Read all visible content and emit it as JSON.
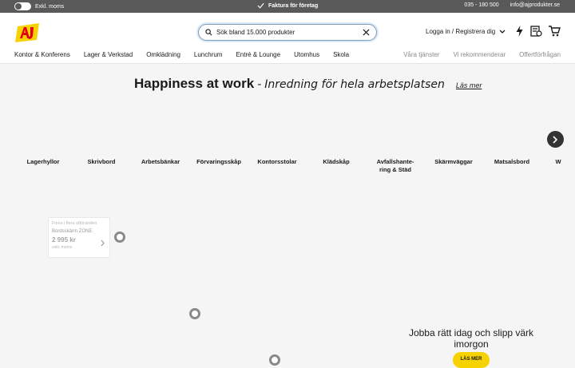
{
  "topbar": {
    "moms_label": "Exkl. moms",
    "center_label": "Faktura för företag",
    "phone": "035 - 180 500",
    "email": "info@ajprodukter.se"
  },
  "header": {
    "search_placeholder": "Sök bland 15.000 produkter",
    "login_label": "Logga in / Registrera dig"
  },
  "nav": {
    "left": [
      "Kontor & Konferens",
      "Lager & Verkstad",
      "Omklädning",
      "Lunchrum",
      "Entré & Lounge",
      "Utomhus",
      "Skola"
    ],
    "right": [
      "Våra tjänster",
      "Vi rekommenderar",
      "Offertförfrågan"
    ]
  },
  "hero": {
    "title": "Happiness at work",
    "dash": "-",
    "subtitle": "Inredning för hela arbetsplatsen",
    "more": "Läs mer"
  },
  "categories": [
    "Lagerhyllor",
    "Skrivbord",
    "Arbetsbänkar",
    "Förvaringsskåp",
    "Kontorsstolar",
    "Klädskåp",
    "Avfallshante-ring & Städ",
    "Skärmväggar",
    "Matsalsbord",
    "W"
  ],
  "product_card": {
    "category": "Finns i flera utföranden",
    "name": "Bordsskärm ZONE",
    "price": "2 995 kr",
    "tax": "exkl. moms"
  },
  "promo": {
    "text": "Jobba rätt idag och slipp värk imorgon",
    "button": "LÄS MER"
  },
  "colors": {
    "topbar": "#595959",
    "accent_yellow": "#f6d300",
    "logo_red": "#e2001a"
  }
}
